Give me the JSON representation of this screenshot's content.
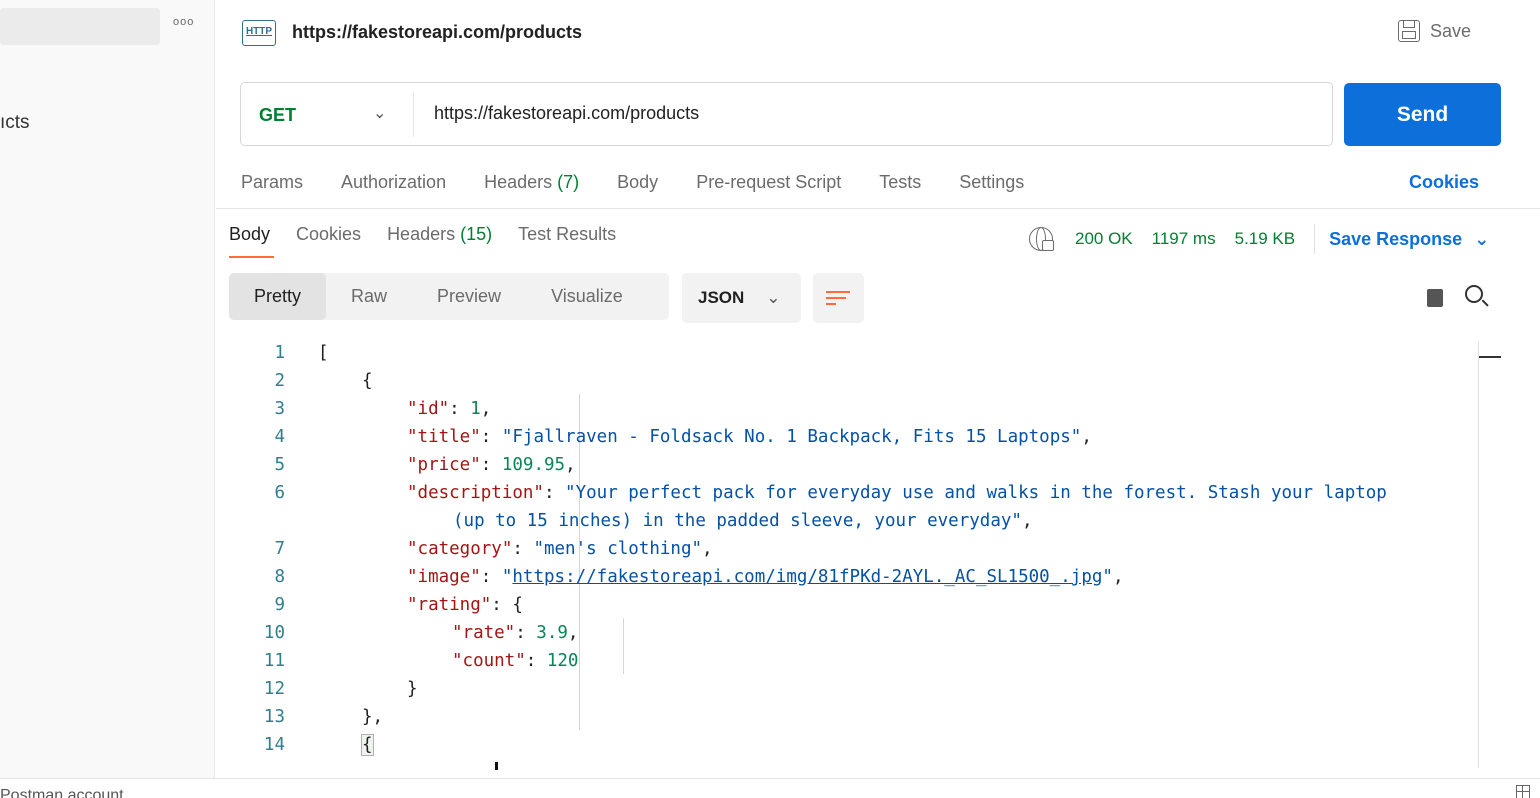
{
  "sidebar": {
    "more_label": "ooo",
    "partial_item": "ıcts"
  },
  "request": {
    "title": "https://fakestoreapi.com/products",
    "http_icon_text": "HTTP",
    "save_label": "Save",
    "method": "GET",
    "url": "https://fakestoreapi.com/products",
    "send_label": "Send"
  },
  "request_tabs": {
    "params": "Params",
    "authorization": "Authorization",
    "headers": "Headers",
    "headers_count": "(7)",
    "body": "Body",
    "prerequest": "Pre-request Script",
    "tests": "Tests",
    "settings": "Settings",
    "cookies": "Cookies"
  },
  "response_tabs": {
    "body": "Body",
    "cookies": "Cookies",
    "headers": "Headers",
    "headers_count": "(15)",
    "test_results": "Test Results"
  },
  "response_status": {
    "status": "200 OK",
    "time": "1197 ms",
    "size": "5.19 KB",
    "save_response": "Save Response"
  },
  "view": {
    "pretty": "Pretty",
    "raw": "Raw",
    "preview": "Preview",
    "visualize": "Visualize",
    "format": "JSON"
  },
  "code_lines": [
    {
      "n": "1"
    },
    {
      "n": "2"
    },
    {
      "n": "3"
    },
    {
      "n": "4"
    },
    {
      "n": "5"
    },
    {
      "n": "6"
    },
    {
      "n": "7"
    },
    {
      "n": "8"
    },
    {
      "n": "9"
    },
    {
      "n": "10"
    },
    {
      "n": "11"
    },
    {
      "n": "12"
    },
    {
      "n": "13"
    },
    {
      "n": "14"
    }
  ],
  "json_body": {
    "id_key": "\"id\"",
    "id_val": "1",
    "title_key": "\"title\"",
    "title_val": "\"Fjallraven - Foldsack No. 1 Backpack, Fits 15 Laptops\"",
    "price_key": "\"price\"",
    "price_val": "109.95",
    "description_key": "\"description\"",
    "description_val_1": "\"Your perfect pack for everyday use and walks in the forest. Stash your laptop",
    "description_val_2": "(up to 15 inches) in the padded sleeve, your everyday\"",
    "category_key": "\"category\"",
    "category_val": "\"men's clothing\"",
    "image_key": "\"image\"",
    "image_url": "https://fakestoreapi.com/img/81fPKd-2AYL._AC_SL1500_.jpg",
    "rating_key": "\"rating\"",
    "rate_key": "\"rate\"",
    "rate_val": "3.9",
    "count_key": "\"count\"",
    "count_val": "120"
  },
  "footer": {
    "text": "Postman account"
  },
  "colors": {
    "send_button": "#0d6fd9",
    "method_get": "#007f31",
    "status_ok": "#007f31",
    "accent_orange": "#ff6c37"
  }
}
